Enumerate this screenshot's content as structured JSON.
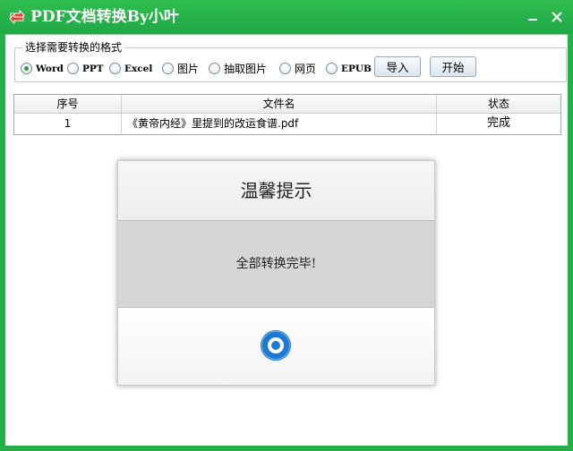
{
  "window": {
    "title": "PDF文档转换By小叶",
    "minimize_glyph": "—",
    "close_glyph": "✕"
  },
  "format_group": {
    "legend": "选择需要转换的格式",
    "options": [
      {
        "label": "Word",
        "checked": true
      },
      {
        "label": "PPT",
        "checked": false
      },
      {
        "label": "Excel",
        "checked": false
      },
      {
        "label": "图片",
        "checked": false
      },
      {
        "label": "抽取图片",
        "checked": false
      },
      {
        "label": "网页",
        "checked": false
      },
      {
        "label": "EPUB",
        "checked": false
      }
    ],
    "import_label": "导入",
    "start_label": "开始"
  },
  "table": {
    "headers": [
      "序号",
      "文件名",
      "状态"
    ],
    "rows": [
      {
        "index": "1",
        "filename": "《黄帝内经》里提到的改运食谱.pdf",
        "status": "完成"
      }
    ]
  },
  "dialog": {
    "title": "温馨提示",
    "message": "全部转换完毕!"
  },
  "colors": {
    "accent": "#25b04a",
    "dialog_button": "#1e78d2"
  }
}
